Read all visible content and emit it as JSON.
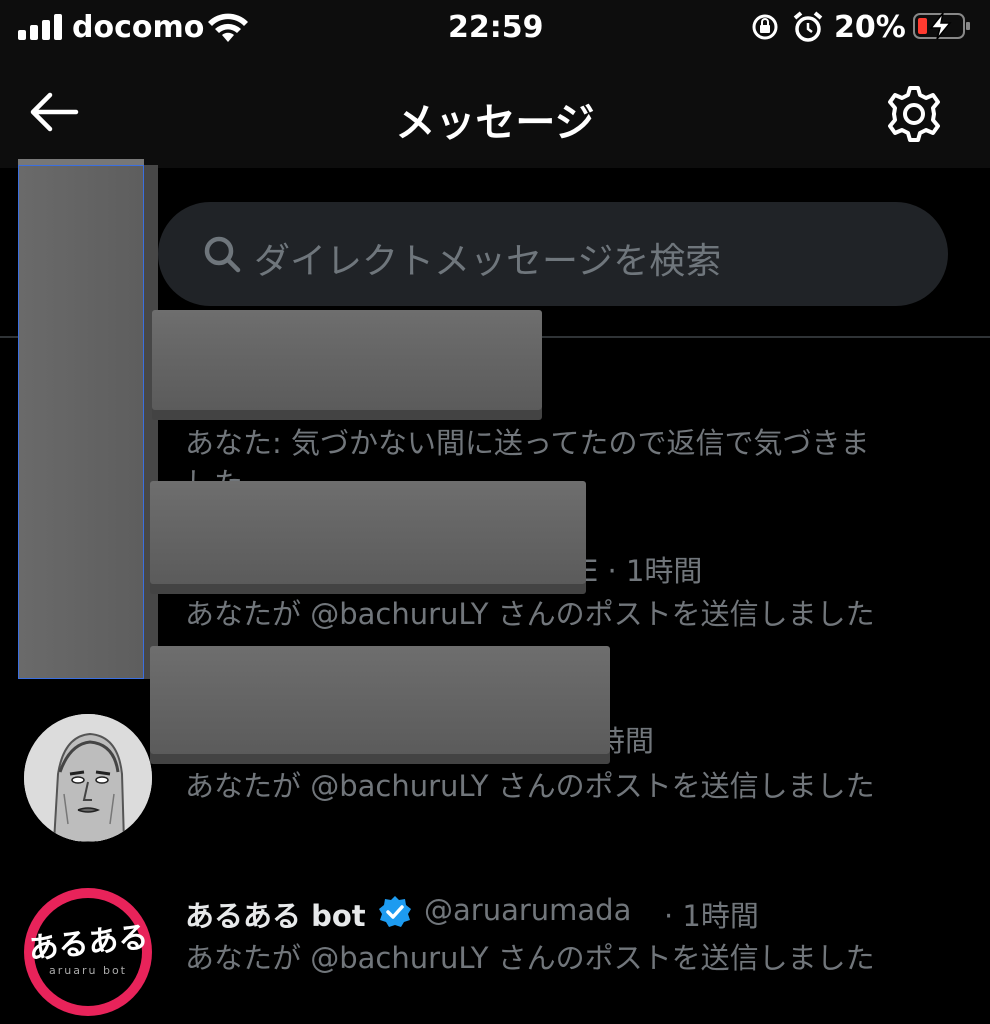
{
  "status_bar": {
    "carrier": "docomo",
    "time": "22:59",
    "battery_percent": "20%",
    "battery_level": 0.2,
    "icons": [
      "signal-icon",
      "wifi-icon",
      "orientation-lock-icon",
      "alarm-icon",
      "battery-charging-icon"
    ]
  },
  "header": {
    "title": "メッセージ",
    "back_icon": "back-arrow-icon",
    "settings_icon": "gear-icon"
  },
  "search": {
    "placeholder": "ダイレクトメッセージを検索"
  },
  "conversations": [
    {
      "preview_line1": "あなた: 気づかない間に送ってたので返信で気づきま",
      "preview_line2": "した"
    },
    {
      "meta": "E · 1時間",
      "preview": "あなたが @bachuruLY さんのポストを送信しました"
    },
    {
      "meta": "時間",
      "preview": "あなたが @bachuruLY さんのポストを送信しました"
    },
    {
      "name": "あるある bot",
      "handle": "@aruarumada",
      "time": "· 1時間",
      "preview": "あなたが @bachuruLY さんのポストを送信しました",
      "avatar_text": "あるある",
      "avatar_subtext": "aruaru bot"
    }
  ],
  "colors": {
    "background": "#000000",
    "search_bg": "#202327",
    "verified": "#1d9bf0",
    "logo": "#e8235a"
  }
}
